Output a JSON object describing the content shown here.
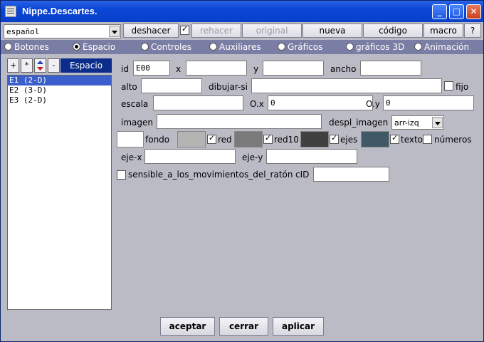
{
  "window": {
    "title": "Nippe.Descartes."
  },
  "toolbar": {
    "language": "español",
    "undo": "deshacer",
    "redo": "rehacer",
    "original": "original",
    "new": "nueva",
    "code": "código",
    "macro": "macro",
    "help": "?"
  },
  "radios": [
    {
      "label": "Botones",
      "selected": false
    },
    {
      "label": "Espacio",
      "selected": true
    },
    {
      "label": "Controles",
      "selected": false
    },
    {
      "label": "Auxiliares",
      "selected": false
    },
    {
      "label": "Gráficos",
      "selected": false
    },
    {
      "label": "gráficos 3D",
      "selected": false
    },
    {
      "label": "Animación",
      "selected": false
    }
  ],
  "leftpane": {
    "add": "+",
    "star": "*",
    "remove": "-",
    "header": "Espacio",
    "items": [
      "E1 (2-D)",
      "E2 (3-D)",
      "E3 (2-D)"
    ]
  },
  "form": {
    "id_label": "id",
    "id_value": "E00",
    "x_label": "x",
    "x_value": "",
    "y_label": "y",
    "y_value": "",
    "ancho_label": "ancho",
    "ancho_value": "",
    "alto_label": "alto",
    "alto_value": "",
    "dibujar_label": "dibujar-si",
    "dibujar_value": "",
    "fijo_label": "fijo",
    "escala_label": "escala",
    "escala_value": "",
    "ox_label": "O.x",
    "ox_value": "0",
    "oy_label": "O.y",
    "oy_value": "0",
    "imagen_label": "imagen",
    "imagen_value": "",
    "despl_label": "despl_imagen",
    "despl_value": "arr-izq",
    "fondo_label": "fondo",
    "red_label": "red",
    "red10_label": "red10",
    "ejes_label": "ejes",
    "texto_label": "texto",
    "numeros_label": "números",
    "ejex_label": "eje-x",
    "ejex_value": "",
    "ejey_label": "eje-y",
    "ejey_value": "",
    "sensible_label": "sensible_a_los_movimientos_del_ratón",
    "cid_label": "cID",
    "cid_value": ""
  },
  "colors": {
    "fondo": "#ffffff",
    "red": "#b4b4b4",
    "red10": "#7a7a7a",
    "ejes": "#404040",
    "texto": "#3f5a66"
  },
  "buttons": {
    "accept": "aceptar",
    "close": "cerrar",
    "apply": "aplicar"
  }
}
